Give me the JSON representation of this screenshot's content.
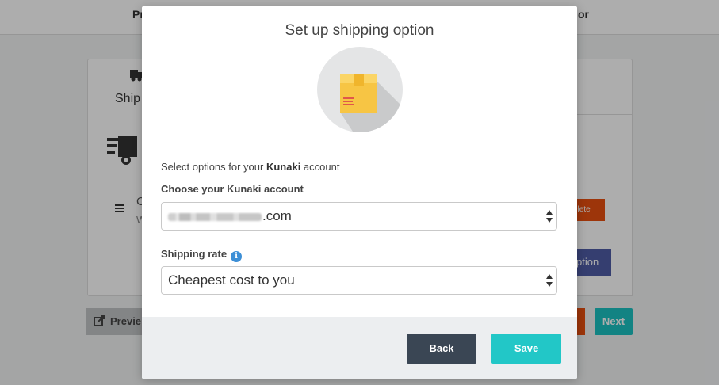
{
  "background": {
    "nav_left": "Pr",
    "nav_right": "or",
    "card_title_partial": "Ship",
    "item_text_partial": "C",
    "item_sub_partial": "W",
    "delete_label": "elete",
    "option_label": "ption",
    "preview_label": "Previe",
    "next_label": "Next"
  },
  "modal": {
    "title": "Set up shipping option",
    "icon": "package-box-icon",
    "description_prefix": "Select options for your ",
    "description_brand": "Kunaki",
    "description_suffix": " account",
    "account_label": "Choose your Kunaki account",
    "account_value_suffix": ".com",
    "rate_label": "Shipping rate",
    "rate_info_icon": "i",
    "rate_value": "Cheapest cost to you",
    "back_label": "Back",
    "save_label": "Save"
  },
  "colors": {
    "save": "#22c7c7",
    "back": "#3a4654",
    "info": "#3d8fd6",
    "delete": "#e84e0f",
    "option": "#4e5ca6"
  }
}
